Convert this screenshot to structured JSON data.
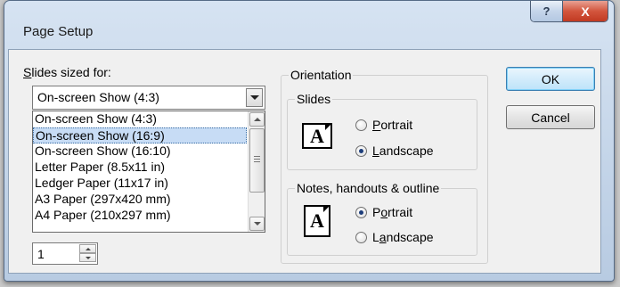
{
  "window": {
    "title": "Page Setup",
    "help_label": "?",
    "close_label": "X"
  },
  "slides_sized_for": {
    "label_mnemonic": "S",
    "label_rest": "lides sized for:",
    "selected_value": "On-screen Show (4:3)",
    "options": [
      "On-screen Show (4:3)",
      "On-screen Show (16:9)",
      "On-screen Show (16:10)",
      "Letter Paper (8.5x11 in)",
      "Ledger Paper (11x17 in)",
      "A3 Paper (297x420 mm)",
      "A4 Paper (210x297 mm)"
    ],
    "highlighted_index": 1
  },
  "number_slides_from": {
    "value": "1"
  },
  "orientation": {
    "title": "Orientation",
    "slides": {
      "title": "Slides",
      "icon_letter": "A",
      "portrait_mnemonic": "P",
      "portrait_rest": "ortrait",
      "landscape_mnemonic": "L",
      "landscape_rest": "andscape",
      "selected": "landscape"
    },
    "notes": {
      "title": "Notes, handouts & outline",
      "icon_letter": "A",
      "portrait_pre": "P",
      "portrait_mnemonic": "o",
      "portrait_rest": "rtrait",
      "landscape_pre": "L",
      "landscape_mnemonic": "a",
      "landscape_rest": "ndscape",
      "selected": "portrait"
    }
  },
  "buttons": {
    "ok": "OK",
    "cancel": "Cancel"
  }
}
